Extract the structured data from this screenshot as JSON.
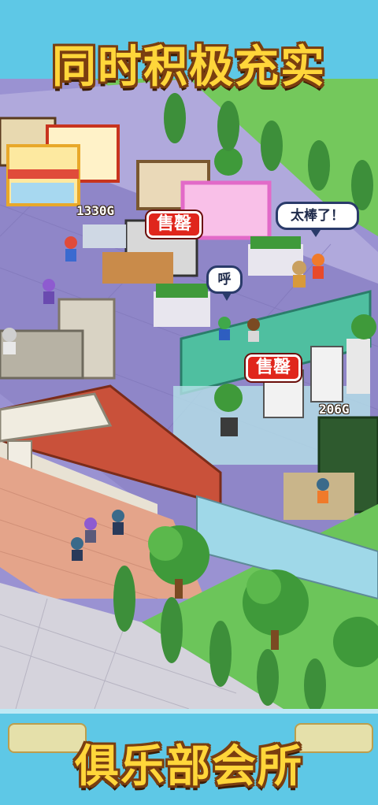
{
  "banner": {
    "top_title": "同时积极充实",
    "bottom_title": "俱乐部会所"
  },
  "hud": {
    "price_left": "1330G",
    "price_right": "206G"
  },
  "signs": {
    "sold_top": "售罄",
    "sold_mid": "售罄"
  },
  "speech": {
    "great": "太棒了！",
    "hu": "呼"
  },
  "colors": {
    "sky": "#5ec8e6",
    "floor": "#8f86c8",
    "grass": "#6cc55a",
    "roof": "#c9513a",
    "title_fill": "#ffd63a",
    "title_outline": "#7a3e10",
    "sold_red": "#e0261c"
  }
}
